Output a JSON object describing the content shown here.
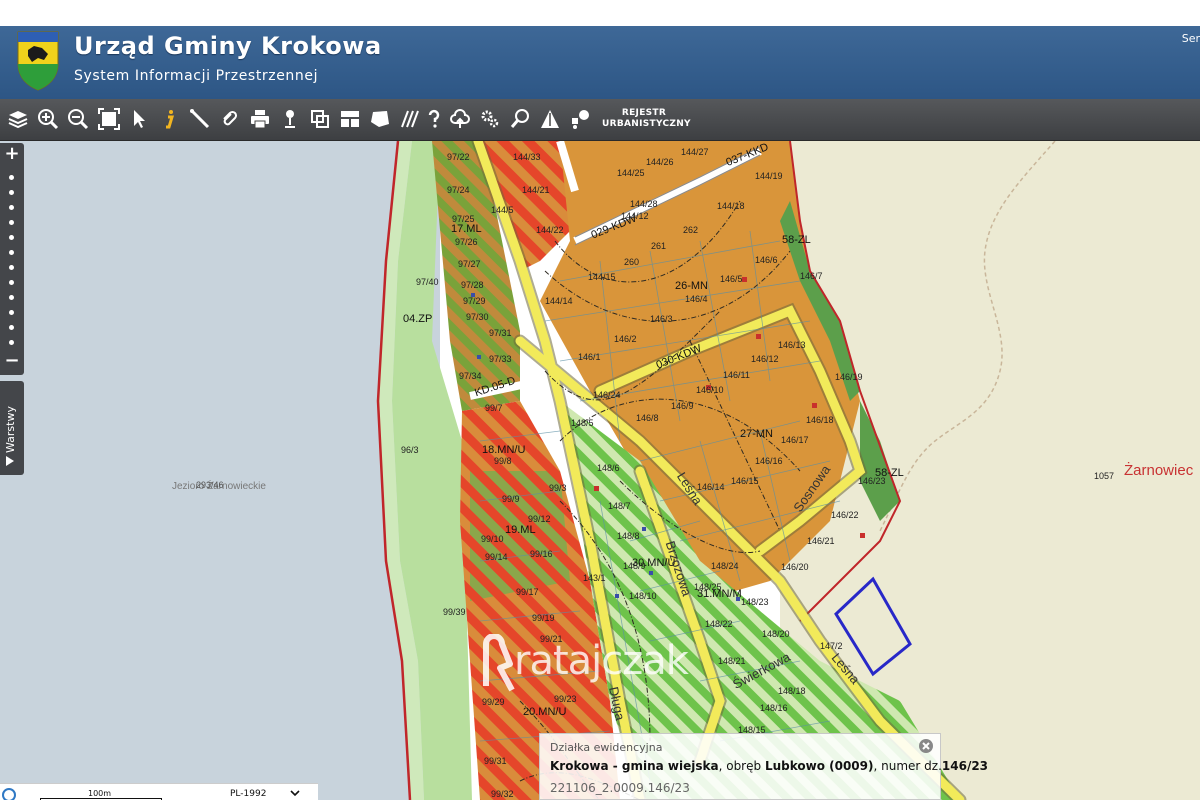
{
  "header": {
    "title": "Urząd Gminy Krokowa",
    "subtitle": "System Informacji Przestrzennej",
    "right_text": "Ser"
  },
  "toolbar": {
    "tools": [
      {
        "name": "layers-icon"
      },
      {
        "name": "zoom-in-icon"
      },
      {
        "name": "zoom-out-icon"
      },
      {
        "name": "full-extent-icon"
      },
      {
        "name": "select-arrow-icon"
      },
      {
        "name": "info-icon"
      },
      {
        "name": "measure-line-icon"
      },
      {
        "name": "link-icon"
      },
      {
        "name": "print-icon"
      },
      {
        "name": "pin-icon"
      },
      {
        "name": "copy-icon"
      },
      {
        "name": "layout-icon"
      },
      {
        "name": "shape-icon"
      },
      {
        "name": "hatch-icon"
      },
      {
        "name": "help-icon"
      },
      {
        "name": "cloud-upload-icon"
      },
      {
        "name": "settings-icon"
      },
      {
        "name": "search-icon"
      },
      {
        "name": "triangle-icon"
      },
      {
        "name": "tools-icon"
      }
    ],
    "rejestr_label_1": "REJESTR",
    "rejestr_label_2": "URBANISTYCZNY"
  },
  "sidebar": {
    "zoom_in": "+",
    "zoom_out": "−",
    "layers_label": "Warstwy"
  },
  "map": {
    "zones": {
      "z04": "04.ZP",
      "z17": "17.ML",
      "z26": "26-MN",
      "z27": "27-MN",
      "z58a": "58-ZL",
      "z58b": "58-ZL",
      "z18": "18.MN/U",
      "z19": "19.ML",
      "z30": "30.MN/U",
      "z31": "31.MN/M",
      "z20": "20.MN/U",
      "kd05": "KD.05-D",
      "kdw029": "029-KDW",
      "kdw030": "030-KDW",
      "kdw037": "037-KKD"
    },
    "parcels": {
      "p97_22": "97/22",
      "p97_24": "97/24",
      "p97_25": "97/25",
      "p97_26": "97/26",
      "p97_27": "97/27",
      "p97_40": "97/40",
      "p97_28": "97/28",
      "p97_29": "97/29",
      "p97_30": "97/30",
      "p97_31": "97/31",
      "p97_33": "97/33",
      "p97_34": "97/34",
      "p144_33": "144/33",
      "p144_21": "144/21",
      "p144_5": "144/5",
      "p144_22": "144/22",
      "p144_26": "144/26",
      "p144_27": "144/27",
      "p144_25": "144/25",
      "p144_28": "144/28",
      "p144_12": "144/12",
      "p144_19": "144/19",
      "p144_18": "144/18",
      "p261": "261",
      "p262": "262",
      "p260": "260",
      "p144_15": "144/15",
      "p144_14": "144/14",
      "p146_6": "146/6",
      "p146_7": "146/7",
      "p146_5": "146/5",
      "p146_4": "146/4",
      "p146_3": "146/3",
      "p146_2": "146/2",
      "p146_1": "146/1",
      "p146_13": "146/13",
      "p146_12": "146/12",
      "p146_11": "146/11",
      "p146_19": "146/19",
      "p146_10": "146/10",
      "p146_24": "146/24",
      "p146_9": "146/9",
      "p146_8": "146/8",
      "p146_18": "146/18",
      "p146_17": "146/17",
      "p146_16": "146/16",
      "p146_15": "146/15",
      "p146_14": "146/14",
      "p146_23": "146/23",
      "p146_22": "146/22",
      "p146_21": "146/21",
      "p146_20": "146/20",
      "p148_5": "148/5",
      "p148_6": "148/6",
      "p148_7": "148/7",
      "p148_8": "148/8",
      "p148_9": "148/9",
      "p148_10": "148/10",
      "p148_24": "148/24",
      "p148_25": "148/25",
      "p148_23": "148/23",
      "p148_22": "148/22",
      "p148_20": "148/20",
      "p148_21": "148/21",
      "p148_18": "148/18",
      "p148_15": "148/15",
      "p148_16": "148/16",
      "p147_2": "147/2",
      "p143_1": "143/1",
      "p99_7": "99/7",
      "p99_8": "99/8",
      "p99_9": "99/9",
      "p99_3": "99/3",
      "p99_12": "99/12",
      "p99_10": "99/10",
      "p99_14": "99/14",
      "p99_16": "99/16",
      "p99_17": "99/17",
      "p99_19": "99/19",
      "p99_21": "99/21",
      "p99_39": "99/39",
      "p99_29": "99/29",
      "p99_23": "99/23",
      "p99_31": "99/31",
      "p99_32": "99/32",
      "p96_3": "96/3",
      "p1057": "1057",
      "p293_46": "293/46"
    },
    "streets": {
      "lesna1": "Leśna",
      "lesna2": "Leśna",
      "sosnowa": "Sosnowa",
      "brzozowa": "Brzozowa",
      "swierkowa": "Świerkowa",
      "dluga": "Długa"
    },
    "places": {
      "lake": "Jezioro Żarnowieckie",
      "village": "Żarnowiec"
    }
  },
  "watermark": {
    "text": "ratajczak"
  },
  "popup": {
    "title": "Działka ewidencyjna",
    "commune": "Krokowa - gmina wiejska",
    "sep1": ", obręb ",
    "precinct": "Lubkowo (0009)",
    "sep2": ", numer dz.",
    "parcel": "146/23",
    "parcel_id": "221106_2.0009.146/23"
  },
  "scale": {
    "label": "100m",
    "crs": "PL-1992"
  },
  "colors": {
    "header": "#3e6897",
    "toolbar": "#4a4c50",
    "orange": "#d9953a",
    "road": "#f2ea5a",
    "green": "#a8d98a",
    "red": "#e53a26",
    "lake": "#c8d3dc",
    "land": "#ecead3",
    "highlight": "#2828c8"
  }
}
